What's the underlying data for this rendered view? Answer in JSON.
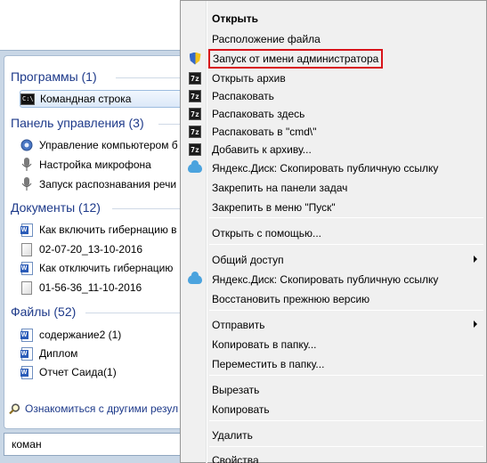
{
  "search_query": "коман",
  "start_menu": {
    "groups": [
      {
        "title": "Программы (1)",
        "items": [
          {
            "label": "Командная строка",
            "icon": "cmd-icon",
            "selected": true
          }
        ]
      },
      {
        "title": "Панель управления (3)",
        "items": [
          {
            "label": "Управление компьютером б",
            "icon": "computer-management-icon"
          },
          {
            "label": "Настройка микрофона",
            "icon": "microphone-icon"
          },
          {
            "label": "Запуск распознавания речи",
            "icon": "microphone-icon"
          }
        ]
      },
      {
        "title": "Документы (12)",
        "items": [
          {
            "label": "Как включить гибернацию в",
            "icon": "word-doc-icon"
          },
          {
            "label": "02-07-20_13-10-2016",
            "icon": "file-icon"
          },
          {
            "label": "Как отключить гибернацию ",
            "icon": "word-doc-icon"
          },
          {
            "label": "01-56-36_11-10-2016",
            "icon": "file-icon"
          }
        ]
      },
      {
        "title": "Файлы (52)",
        "items": [
          {
            "label": "содержание2 (1)",
            "icon": "word-doc-icon"
          },
          {
            "label": "Диплом",
            "icon": "word-doc-icon"
          },
          {
            "label": "Отчет Саида(1)",
            "icon": "word-doc-icon"
          }
        ]
      }
    ],
    "other_results": "Ознакомиться с другими резул"
  },
  "context_menu": {
    "items": [
      {
        "label": "Открыть",
        "bold": true,
        "icon": ""
      },
      {
        "label": "Расположение файла",
        "icon": ""
      },
      {
        "label": "Запуск от имени администратора",
        "icon": "uac-shield-icon",
        "highlighted": true
      },
      {
        "label": "Открыть архив",
        "icon": "archive-icon"
      },
      {
        "label": "Распаковать",
        "icon": "archive-icon"
      },
      {
        "label": "Распаковать здесь",
        "icon": "archive-icon"
      },
      {
        "label": "Распаковать в \"cmd\\\"",
        "icon": "archive-icon"
      },
      {
        "label": "Добавить к архиву...",
        "icon": "archive-icon"
      },
      {
        "label": "Яндекс.Диск: Скопировать публичную ссылку",
        "icon": "yandex-disk-icon"
      },
      {
        "label": "Закрепить на панели задач",
        "icon": ""
      },
      {
        "label": "Закрепить в меню \"Пуск\"",
        "icon": ""
      },
      {
        "label": "Открыть с помощью...",
        "icon": ""
      },
      {
        "label": "Общий доступ",
        "icon": "",
        "submenu": true
      },
      {
        "label": "Яндекс.Диск: Скопировать публичную ссылку",
        "icon": "yandex-disk-icon"
      },
      {
        "label": "Восстановить прежнюю версию",
        "icon": ""
      },
      {
        "label": "Отправить",
        "icon": "",
        "submenu": true
      },
      {
        "label": "Копировать в папку...",
        "icon": ""
      },
      {
        "label": "Переместить в папку...",
        "icon": ""
      },
      {
        "label": "Вырезать",
        "icon": ""
      },
      {
        "label": "Копировать",
        "icon": ""
      },
      {
        "label": "Удалить",
        "icon": ""
      },
      {
        "label": "Свойства",
        "icon": ""
      }
    ],
    "archive_icon_text": "7z",
    "cmd_icon_text": "C:\\",
    "highlight_color": "#d8141a"
  }
}
